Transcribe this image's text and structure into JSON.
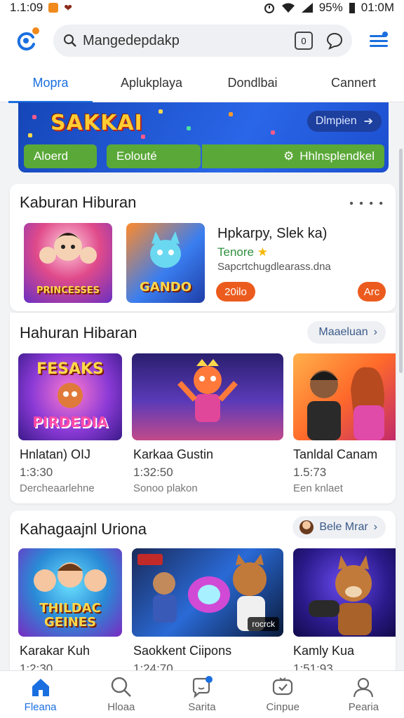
{
  "status_bar": {
    "time": "1.1:09",
    "battery": "95%",
    "clock": "01:0M"
  },
  "search": {
    "placeholder": "Mangedepdakp",
    "qr_label": "0"
  },
  "tabs": [
    {
      "label": "Mopra",
      "active": true
    },
    {
      "label": "Aplukplaya",
      "active": false
    },
    {
      "label": "Dondlbai",
      "active": false
    },
    {
      "label": "Cannert",
      "active": false
    }
  ],
  "banner": {
    "title": "SAKKAI",
    "pill_label": "Dlmpien",
    "button_1": "Aloerd",
    "button_2": "Eolouté",
    "button_3": "Hhlnsplendkel"
  },
  "section_1": {
    "title": "Kaburan Hiburan",
    "games": [
      {
        "art_label": "PRINCESSES"
      },
      {
        "art_label": "GANDO"
      }
    ],
    "featured": {
      "name": "Hpkarpy, Slek ka)",
      "category": "Tenore",
      "desc": "Sapcrtchugdlearass.dna",
      "button_left": "20ilo",
      "button_right": "Arc"
    }
  },
  "section_2": {
    "title": "Hahuran Hibaran",
    "see_all": "Maaeluan",
    "games": [
      {
        "art_label": "PIRDEDIA",
        "name": "Hnlatan) OIJ",
        "size": "1:3:30",
        "sub": "Dercheaarlehne"
      },
      {
        "art_label": "",
        "name": "Karkaa Gustin",
        "size": "1:32:50",
        "sub": "Sonoo plakon"
      },
      {
        "art_label": "",
        "name": "Tanldal Canam",
        "size": "1.5:73",
        "sub": "Een knlaet"
      }
    ]
  },
  "section_3": {
    "title": "Kahagaajnl Uriona",
    "see_all": "Bele Mrar",
    "games": [
      {
        "art_label": "THILDAC GEINES",
        "name": "Karakar Kuh",
        "size": "1:2:30"
      },
      {
        "art_label": "",
        "badge": "rocrck",
        "name": "Saokkent Ciipons",
        "size": "1:24:70"
      },
      {
        "art_label": "",
        "name": "Kamly Kua",
        "size": "1:51:93"
      }
    ]
  },
  "bottom_nav": [
    {
      "label": "Fleana",
      "icon": "home-icon",
      "active": true
    },
    {
      "label": "Hloaa",
      "icon": "search-icon",
      "active": false
    },
    {
      "label": "Sarita",
      "icon": "chat-icon",
      "active": false
    },
    {
      "label": "Cinpue",
      "icon": "tv-icon",
      "active": false
    },
    {
      "label": "Pearia",
      "icon": "profile-icon",
      "active": false
    }
  ],
  "colors": {
    "accent": "#1a6fe0",
    "orange": "#ec5b1e",
    "green": "#5aa838",
    "banner_blue": "#1c4fcf"
  }
}
